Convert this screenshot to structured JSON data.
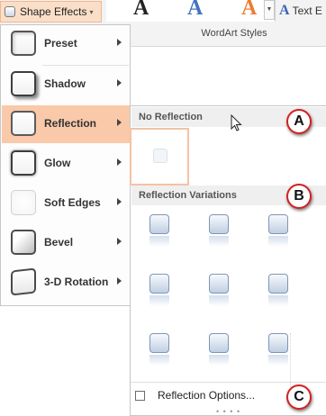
{
  "ribbon": {
    "shape_effects_label": "Shape Effects",
    "gallery_letters": [
      "A",
      "A",
      "A"
    ],
    "gallery_colors": [
      "#222222",
      "#4472c4",
      "#ed7d31"
    ],
    "text_effects_label": "Text E",
    "group_label": "WordArt Styles"
  },
  "menu": {
    "items": [
      {
        "label": "Preset",
        "icon": "preset-effect-icon"
      },
      {
        "label": "Shadow",
        "icon": "shadow-effect-icon"
      },
      {
        "label": "Reflection",
        "icon": "reflection-effect-icon",
        "active": true
      },
      {
        "label": "Glow",
        "icon": "glow-effect-icon"
      },
      {
        "label": "Soft Edges",
        "icon": "soft-edges-effect-icon"
      },
      {
        "label": "Bevel",
        "icon": "bevel-effect-icon"
      },
      {
        "label": "3-D Rotation",
        "icon": "3d-rotation-effect-icon"
      }
    ]
  },
  "reflection": {
    "no_reflection_header": "No Reflection",
    "variations_header": "Reflection Variations",
    "options_label": "Reflection Options..."
  },
  "callouts": {
    "a": "A",
    "b": "B",
    "c": "C"
  },
  "colors": {
    "active_highlight": "#f9c9aa",
    "callout_ring": "#d42121",
    "variation_tile": "#bfcfe2"
  }
}
